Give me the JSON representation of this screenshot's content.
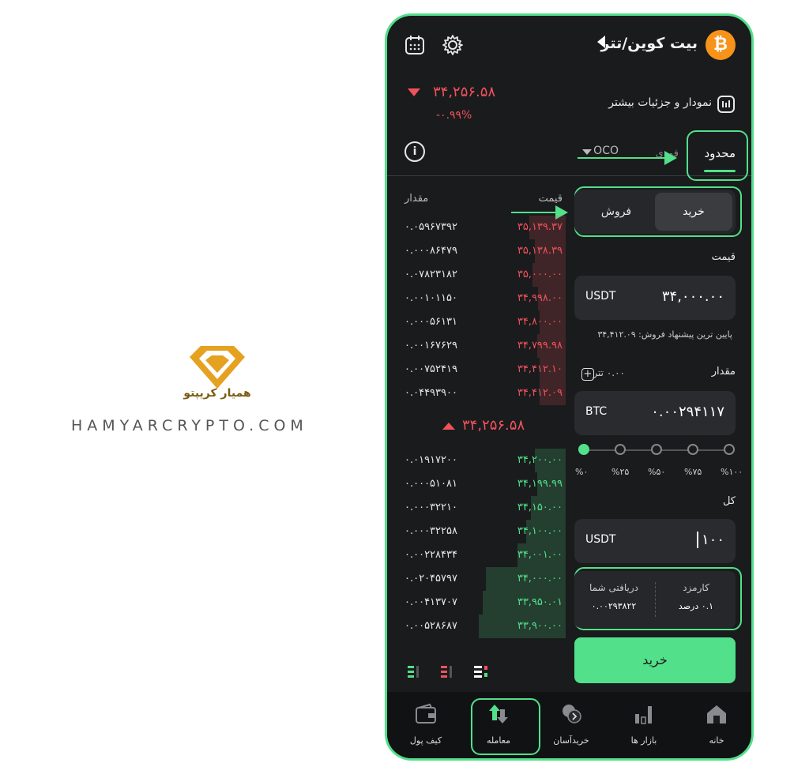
{
  "brand": {
    "name": "همیار کریپتو",
    "site": "HAMYARCRYPTO.COM"
  },
  "header": {
    "pair": "بیت کوین/تتر",
    "btc_symbol": "₿"
  },
  "ticker": {
    "last_price": "۳۴,۲۵۶.۵۸",
    "change": "-۰.۹۹%",
    "chart_link": "نمودار و جزئیات بیشتر"
  },
  "tabs": {
    "limit": "محدود",
    "market": "فوری",
    "oco": "OCO",
    "info": "i"
  },
  "orderbook": {
    "qty_header": "مقدار",
    "price_header": "قیمت",
    "asks": [
      {
        "qty": "۰.۰۵۹۶۷۳۹۲",
        "price": "۳۵,۱۳۹.۳۷",
        "depth": 0.42
      },
      {
        "qty": "۰.۰۰۰۸۶۴۷۹",
        "price": "۳۵,۱۳۸.۳۹",
        "depth": 0.35
      },
      {
        "qty": "۰.۰۷۸۲۳۱۸۲",
        "price": "۳۵,۰۰۰.۰۰",
        "depth": 0.38
      },
      {
        "qty": "۰.۰۰۱۰۱۱۵۰",
        "price": "۳۴,۹۹۸.۰۰",
        "depth": 0.32
      },
      {
        "qty": "۰.۰۰۰۵۶۱۳۱",
        "price": "۳۴,۸۰۰.۰۰",
        "depth": 0.3
      },
      {
        "qty": "۰.۰۰۱۶۷۶۲۹",
        "price": "۳۴,۷۹۹.۹۸",
        "depth": 0.33
      },
      {
        "qty": "۰.۰۰۷۵۲۴۱۹",
        "price": "۳۴,۴۱۲.۱۰",
        "depth": 0.3
      },
      {
        "qty": "۰.۰۴۴۹۳۹۰۰",
        "price": "۳۴,۴۱۲.۰۹",
        "depth": 0.3
      }
    ],
    "mid_price": "۳۴,۲۵۶.۵۸",
    "bids": [
      {
        "qty": "۰.۰۱۹۱۷۲۰۰",
        "price": "۳۴,۲۰۰.۰۰",
        "depth": 0.35
      },
      {
        "qty": "۰.۰۰۰۵۱۰۸۱",
        "price": "۳۴,۱۹۹.۹۹",
        "depth": 0.33
      },
      {
        "qty": "۰.۰۰۰۳۲۲۱۰",
        "price": "۳۴,۱۵۰.۰۰",
        "depth": 0.4
      },
      {
        "qty": "۰.۰۰۰۳۲۲۵۸",
        "price": "۳۴,۱۰۰.۰۰",
        "depth": 0.45
      },
      {
        "qty": "۰.۰۰۲۲۸۴۳۴",
        "price": "۳۴,۰۰۱.۰۰",
        "depth": 0.55
      },
      {
        "qty": "۰.۰۲۰۴۵۷۹۷",
        "price": "۳۴,۰۰۰.۰۰",
        "depth": 0.92
      },
      {
        "qty": "۰.۰۰۴۱۳۷۰۷",
        "price": "۳۳,۹۵۰.۰۱",
        "depth": 0.95
      },
      {
        "qty": "۰.۰۰۵۲۸۶۸۷",
        "price": "۳۳,۹۰۰.۰۰",
        "depth": 1.0
      }
    ]
  },
  "form": {
    "buy_label": "خرید",
    "sell_label": "فروش",
    "price_label": "قیمت",
    "price_currency": "USDT",
    "price_value": "۳۴,۰۰۰.۰۰",
    "lowest_ask_hint": "پایین ترین پیشنهاد فروش: ۳۴,۴۱۲.۰۹",
    "amount_label": "مقدار",
    "balance": "۰.۰۰ تتر",
    "amount_currency": "BTC",
    "amount_value": "۰.۰۰۲۹۴۱۱۷",
    "slider_labels": [
      "%۰",
      "%۲۵",
      "%۵۰",
      "%۷۵",
      "%۱۰۰"
    ],
    "slider_value": 0,
    "total_label": "کل",
    "total_currency": "USDT",
    "total_value": "۱۰۰",
    "fee_label": "کارمزد",
    "fee_value": "۰.۱ درصد",
    "receive_label": "دریافتی شما",
    "receive_value": "۰.۰۰۲۹۳۸۲۲",
    "submit_label": "خرید"
  },
  "nav": {
    "home": "خانه",
    "markets": "بازار ها",
    "easy_buy": "خریدآسان",
    "trade": "معامله",
    "wallet": "کیف پول"
  },
  "colors": {
    "accent": "#52e08a",
    "sell": "#f0525c",
    "bg": "#1a1b1d",
    "brand_gold": "#e5a120"
  }
}
